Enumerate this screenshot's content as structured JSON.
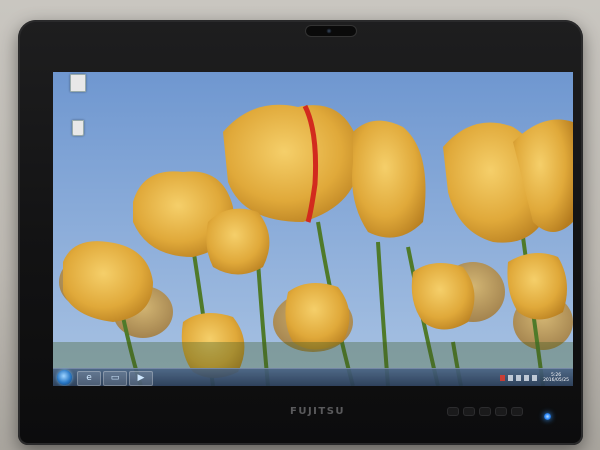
{
  "desktop": {
    "icons": [
      {
        "label": "",
        "icon": "folder-icon"
      },
      {
        "label": "",
        "icon": "recycle-bin-icon"
      }
    ]
  },
  "taskbar": {
    "buttons": [
      {
        "icon": "ie-icon",
        "glyph": "e"
      },
      {
        "icon": "explorer-icon",
        "glyph": "▭"
      },
      {
        "icon": "media-icon",
        "glyph": "▶"
      }
    ],
    "clock": {
      "time": "5:26",
      "date": "2016/05/25"
    }
  },
  "monitor": {
    "brand": "FUJITSU"
  },
  "colors": {
    "sky": "#7ea3d6",
    "tulip": "#e0a93a",
    "stem": "#4f7a2a",
    "taskbar": "#3a5478",
    "led": "#2f8cff"
  }
}
